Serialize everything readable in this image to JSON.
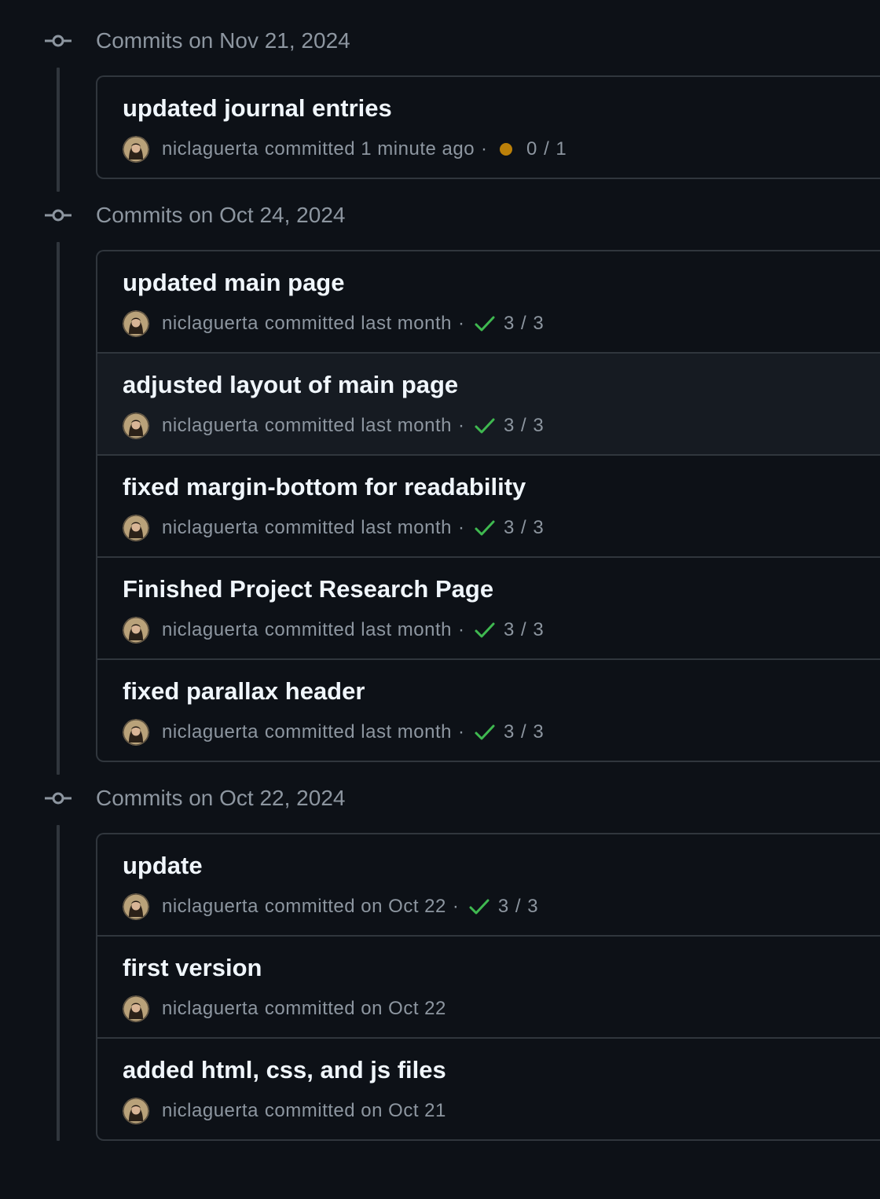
{
  "colors": {
    "background": "#0d1117",
    "border": "#30363d",
    "muted_text": "#8d96a0",
    "title_text": "#f0f6fc",
    "success": "#3fb950",
    "pending": "#bb8009",
    "hover_row": "#161b22"
  },
  "groups": [
    {
      "title": "Commits on Nov 21, 2024",
      "commits": [
        {
          "message": "updated journal entries",
          "author": "niclaguerta",
          "committed_text": "committed 1 minute ago",
          "status": "pending",
          "status_icon": "pending-dot-icon",
          "checks": "0 / 1"
        }
      ]
    },
    {
      "title": "Commits on Oct 24, 2024",
      "commits": [
        {
          "message": "updated main page",
          "author": "niclaguerta",
          "committed_text": "committed last month",
          "status": "success",
          "status_icon": "check-icon",
          "checks": "3 / 3"
        },
        {
          "message": "adjusted layout of main page",
          "author": "niclaguerta",
          "committed_text": "committed last month",
          "status": "success",
          "status_icon": "check-icon",
          "checks": "3 / 3"
        },
        {
          "message": "fixed margin-bottom for readability",
          "author": "niclaguerta",
          "committed_text": "committed last month",
          "status": "success",
          "status_icon": "check-icon",
          "checks": "3 / 3"
        },
        {
          "message": "Finished Project Research Page",
          "author": "niclaguerta",
          "committed_text": "committed last month",
          "status": "success",
          "status_icon": "check-icon",
          "checks": "3 / 3"
        },
        {
          "message": "fixed parallax header",
          "author": "niclaguerta",
          "committed_text": "committed last month",
          "status": "success",
          "status_icon": "check-icon",
          "checks": "3 / 3"
        }
      ]
    },
    {
      "title": "Commits on Oct 22, 2024",
      "commits": [
        {
          "message": "update",
          "author": "niclaguerta",
          "committed_text": "committed on Oct 22",
          "status": "success",
          "status_icon": "check-icon",
          "checks": "3 / 3"
        },
        {
          "message": "first version",
          "author": "niclaguerta",
          "committed_text": "committed on Oct 22"
        },
        {
          "message": "added html, css, and js files",
          "author": "niclaguerta",
          "committed_text": "committed on Oct 21"
        }
      ]
    }
  ]
}
